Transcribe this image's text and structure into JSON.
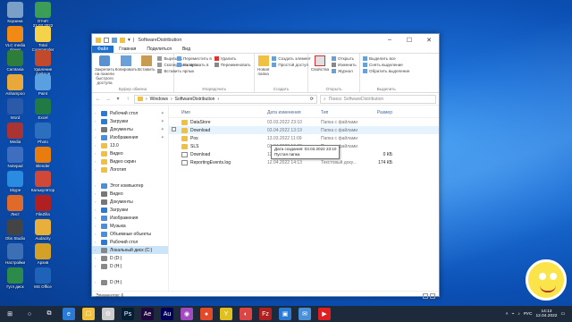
{
  "desktop": {
    "icons": [
      {
        "label": "Корзина",
        "color": "#7aa0c8"
      },
      {
        "label": "Отчёт 22.03.2022",
        "color": "#3c9d56"
      },
      {
        "label": "VLC media player",
        "color": "#f08a14"
      },
      {
        "label": "Total Commander",
        "color": "#f5d24a"
      },
      {
        "label": "Camtasia",
        "color": "#2f7d3a"
      },
      {
        "label": "Удаление файлов",
        "color": "#c04a2b"
      },
      {
        "label": "Ashampoo",
        "color": "#e8a93a"
      },
      {
        "label": "Paint",
        "color": "#5aa0e0"
      },
      {
        "label": "Word",
        "color": "#2b5ba8"
      },
      {
        "label": "Excel",
        "color": "#1f7a44"
      },
      {
        "label": "Media",
        "color": "#aa3333"
      },
      {
        "label": "Photo",
        "color": "#2d6fbf"
      },
      {
        "label": "Notepad",
        "color": "#3f6ec0"
      },
      {
        "label": "Blender",
        "color": "#e87d0d"
      },
      {
        "label": "Skype",
        "color": "#2a8be0"
      },
      {
        "label": "Калькулятор",
        "color": "#d14836"
      },
      {
        "label": "Лист",
        "color": "#e06a2a"
      },
      {
        "label": "FileZilla",
        "color": "#b02020"
      },
      {
        "label": "Obs Studio",
        "color": "#444444"
      },
      {
        "label": "Audacity",
        "color": "#e8b03a"
      },
      {
        "label": "Настройки",
        "color": "#3c6fb3"
      },
      {
        "label": "Архив",
        "color": "#d4a025"
      },
      {
        "label": "Гугл диск",
        "color": "#2c8b4a"
      },
      {
        "label": "MS Office",
        "color": "#1e63b8"
      }
    ]
  },
  "window": {
    "title": "SoftwareDistribution",
    "tabs": [
      "Файл",
      "Главная",
      "Поделиться",
      "Вид"
    ],
    "ribbon": {
      "pin_label": "Закрепить на панели быстрого доступа",
      "copy_label": "Копировать",
      "paste_label": "Вставить",
      "cut_label": "Вырезать",
      "copy_path_label": "Скопировать путь",
      "paste_shortcut_label": "Вставить ярлык",
      "clipboard_group": "Буфер обмена",
      "move_to_label": "Переместить в",
      "copy_to_label": "Копировать в",
      "delete_label": "Удалить",
      "rename_label": "Переименовать",
      "organize_group": "Упорядочить",
      "new_folder_label": "Новая папка",
      "new_item_label": "Создать элемент",
      "easy_access_label": "Простой доступ",
      "create_group": "Создать",
      "properties_label": "Свойства",
      "open_label": "Открыть",
      "edit_label": "Изменить",
      "history_label": "Журнал",
      "open_group": "Открыть",
      "select_all_label": "Выделить все",
      "select_none_label": "Снять выделение",
      "invert_label": "Обратить выделение",
      "select_group": "Выделить"
    },
    "address": {
      "path": [
        "Windows",
        "SoftwareDistribution"
      ],
      "search_placeholder": "Поиск: SoftwareDistribution"
    },
    "nav": [
      {
        "label": "Рабочий стол",
        "pin": true,
        "color": "#2a7bd6"
      },
      {
        "label": "Загрузки",
        "pin": true,
        "color": "#2a7bd6"
      },
      {
        "label": "Документы",
        "pin": true,
        "color": "#777777"
      },
      {
        "label": "Изображения",
        "pin": true,
        "color": "#4a90d9"
      },
      {
        "label": "13.0",
        "pin": false,
        "color": "#f0c040"
      },
      {
        "label": "Видео",
        "pin": false,
        "color": "#f0c040"
      },
      {
        "label": "Видео скрин",
        "pin": false,
        "color": "#f0c040"
      },
      {
        "label": "Логотип",
        "pin": false,
        "color": "#f0c040"
      },
      {
        "label": "",
        "pin": false,
        "color": "#ffffff"
      },
      {
        "label": "Этот компьютер",
        "pin": false,
        "color": "#4a90d9"
      },
      {
        "label": "Видео",
        "pin": false,
        "color": "#777777"
      },
      {
        "label": "Документы",
        "pin": false,
        "color": "#777777"
      },
      {
        "label": "Загрузки",
        "pin": false,
        "color": "#2a7bd6"
      },
      {
        "label": "Изображения",
        "pin": false,
        "color": "#4a90d9"
      },
      {
        "label": "Музыка",
        "pin": false,
        "color": "#4a90d9"
      },
      {
        "label": "Объемные объекты",
        "pin": false,
        "color": "#4a90d9"
      },
      {
        "label": "Рабочий стол",
        "pin": false,
        "color": "#2a7bd6"
      },
      {
        "label": "Локальный диск (C:)",
        "pin": false,
        "color": "#888888",
        "selected": true
      },
      {
        "label": "D (D:)",
        "pin": false,
        "color": "#888888"
      },
      {
        "label": "D (H:)",
        "pin": false,
        "color": "#888888"
      },
      {
        "label": "",
        "pin": false,
        "color": "#ffffff"
      },
      {
        "label": "D (H:)",
        "pin": false,
        "color": "#888888"
      }
    ],
    "columns": {
      "name": "Имя",
      "modified": "Дата изменения",
      "type": "Тип",
      "size": "Размер"
    },
    "files": [
      {
        "name": "DataStore",
        "modified": "03.03.2022 23:10",
        "type": "Папка с файлами",
        "size": "",
        "kind": "folder"
      },
      {
        "name": "Download",
        "modified": "03.04.2022 13:19",
        "type": "Папка с файлами",
        "size": "",
        "kind": "folder",
        "hover": true
      },
      {
        "name": "Pos",
        "modified": "13.03.2022 11:09",
        "type": "Папка с файлами",
        "size": "",
        "kind": "folder"
      },
      {
        "name": "SLS",
        "modified": "03.04.2022 19:22",
        "type": "Папка с файлами",
        "size": "",
        "kind": "folder"
      },
      {
        "name": "Download",
        "modified": "12.04.2022 13:57",
        "type": "Файл",
        "size": "0 КБ",
        "kind": "file"
      },
      {
        "name": "ReportingEvents.log",
        "modified": "12.04.2022 14:13",
        "type": "Текстовый доку...",
        "size": "174 КБ",
        "kind": "file"
      }
    ],
    "tooltip": {
      "line1": "Дата создания: 03.03.2022 23:10",
      "line2": "Пустая папка"
    },
    "status": "Элементов: 6"
  },
  "taskbar": {
    "items": [
      "⊞",
      "○",
      "⧉",
      "e",
      "☐",
      "⚙",
      "Ps",
      "Ae",
      "Au",
      "◉",
      "●",
      "Y",
      "◐",
      "Fz",
      "▣",
      "✉",
      "▶"
    ],
    "item_colors": [
      "#ffffff",
      "#ffffff",
      "#ffffff",
      "#2a7bd6",
      "#f0c040",
      "#cccccc",
      "#001e36",
      "#1f0740",
      "#00005b",
      "#a24ac0",
      "#e34a2a",
      "#e0c020",
      "#d44",
      "#b02020",
      "#2a7bd6",
      "#4a90d9",
      "#e02020"
    ],
    "lang": "РУС",
    "time": "14:13",
    "date": "12.04.2022"
  }
}
